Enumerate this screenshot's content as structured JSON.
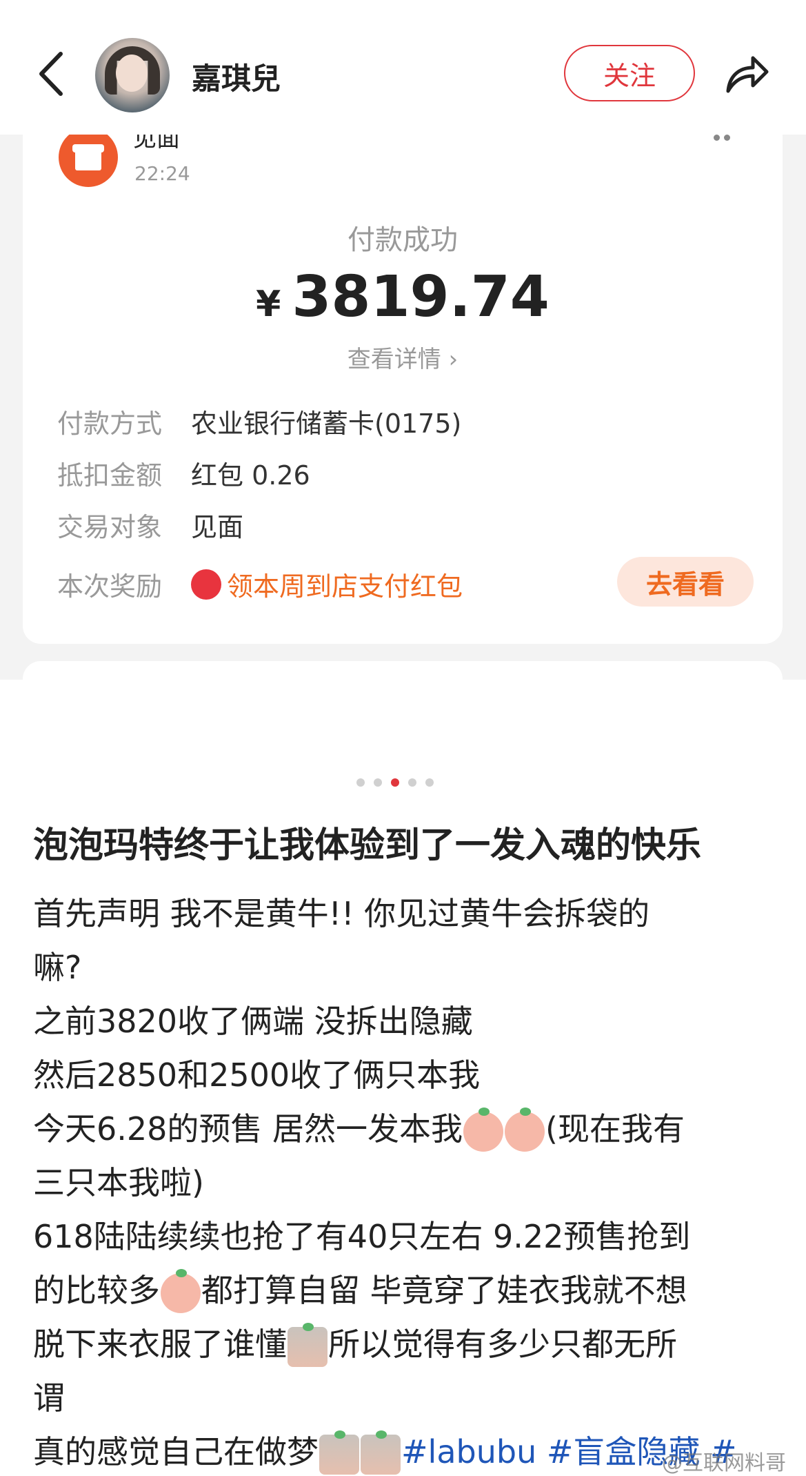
{
  "header": {
    "username": "嘉琪兒",
    "follow_label": "关注"
  },
  "receipt": {
    "shop_name": "见面",
    "time": "22:24",
    "status": "付款成功",
    "currency": "¥",
    "amount": "3819.74",
    "detail_link": "查看详情 ›",
    "rows": [
      {
        "label": "付款方式",
        "value": "农业银行储蓄卡(0175)"
      },
      {
        "label": "抵扣金额",
        "value": "红包 0.26"
      },
      {
        "label": "交易对象",
        "value": "见面"
      }
    ],
    "reward_label": "本次奖励",
    "reward_text": "领本周到店支付红包",
    "reward_button": "去看看"
  },
  "carousel": {
    "count": 5,
    "active_index": 2
  },
  "post": {
    "title": "泡泡玛特终于让我体验到了一发入魂的快乐",
    "lines": [
      "首先声明 我不是黄牛!! 你见过黄牛会拆袋的",
      "嘛?",
      "之前3820收了俩端 没拆出隐藏",
      "然后2850和2500收了俩只本我",
      "今天6.28的预售 居然一发本我",
      "(现在我有",
      "三只本我啦)",
      "618陆陆续续也抢了有40只左右 9.22预售抢到",
      "的比较多",
      "都打算自留 毕竟穿了娃衣我就不想",
      "脱下来衣服了谁懂",
      "所以觉得有多少只都无所",
      "谓",
      "真的感觉自己在做梦",
      "#labubu #盲盒隐藏 #"
    ]
  },
  "watermark": "@互联网料哥"
}
